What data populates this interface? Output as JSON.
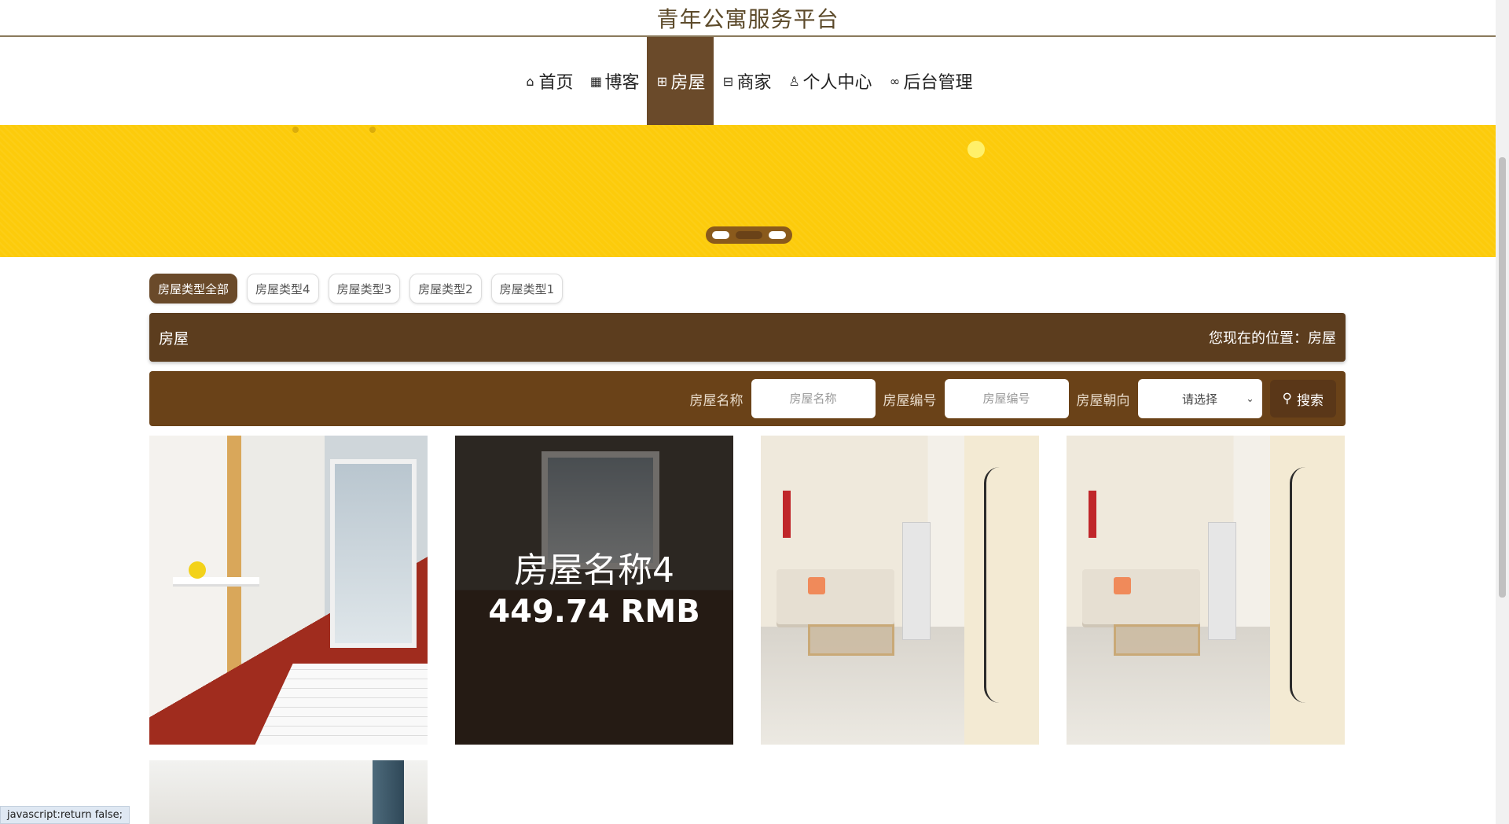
{
  "site_title": "青年公寓服务平台",
  "nav": [
    {
      "icon": "⌂",
      "label": "首页",
      "active": false
    },
    {
      "icon": "▦",
      "label": "博客",
      "active": false
    },
    {
      "icon": "⊞",
      "label": "房屋",
      "active": true
    },
    {
      "icon": "⊟",
      "label": "商家",
      "active": false
    },
    {
      "icon": "♙",
      "label": "个人中心",
      "active": false
    },
    {
      "icon": "∞",
      "label": "后台管理",
      "active": false
    }
  ],
  "categories": [
    "房屋类型全部",
    "房屋类型4",
    "房屋类型3",
    "房屋类型2",
    "房屋类型1"
  ],
  "section": {
    "title": "房屋",
    "breadcrumb": "您现在的位置：房屋"
  },
  "search": {
    "name_label": "房屋名称",
    "name_placeholder": "房屋名称",
    "code_label": "房屋编号",
    "code_placeholder": "房屋编号",
    "orientation_label": "房屋朝向",
    "orientation_value": "请选择",
    "button": "搜索"
  },
  "cards": [
    {
      "name": "房屋名称4",
      "price": "449.74 RMB"
    }
  ],
  "status_text": "javascript:return false;",
  "colors": {
    "accent_brown": "#6a4a2a",
    "banner_yellow": "#fccb0b"
  }
}
